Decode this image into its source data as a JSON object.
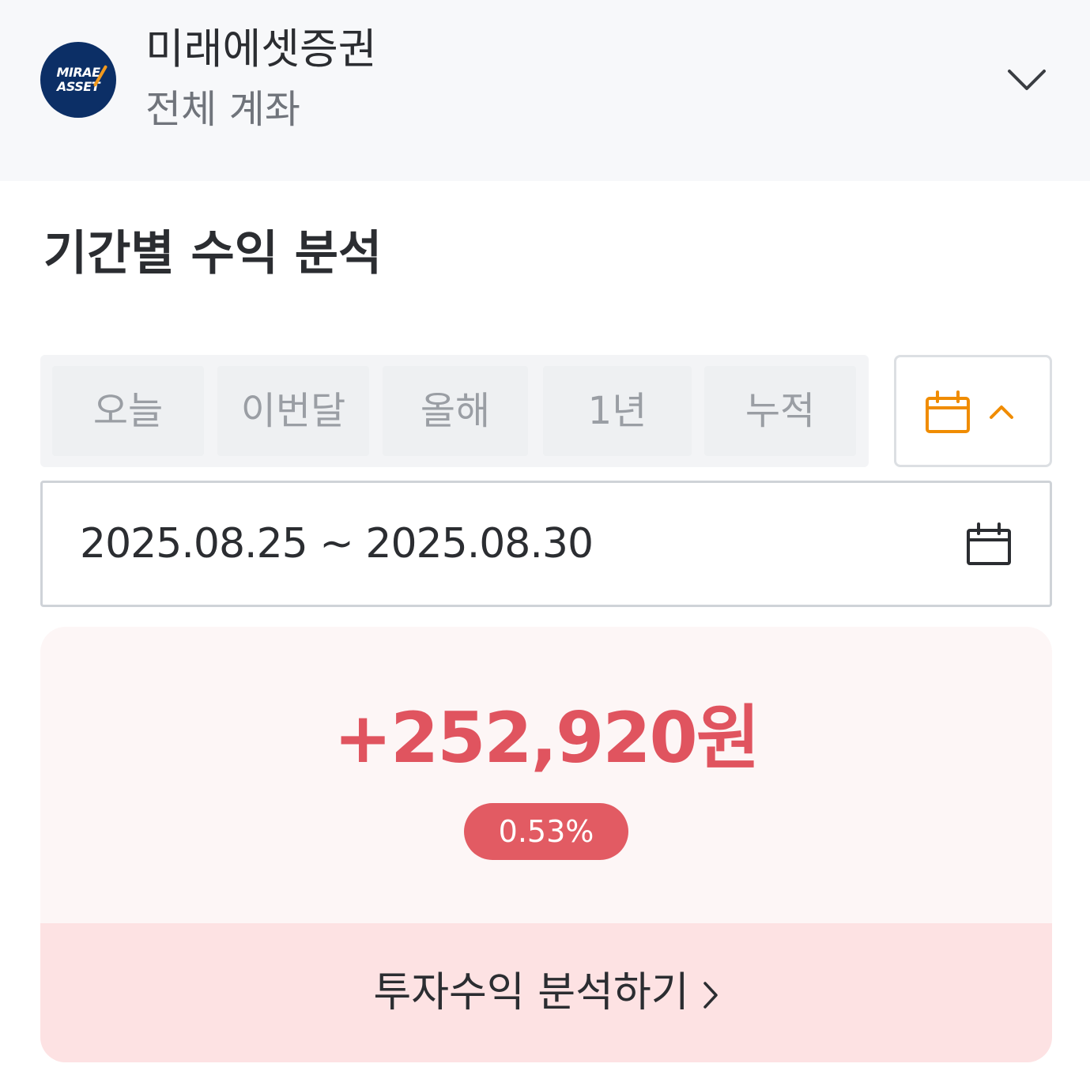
{
  "header": {
    "logo_line1": "MIRAE",
    "logo_line2": "ASSET",
    "broker_name": "미래에셋증권",
    "account_name": "전체 계좌",
    "dropdown_icon": "chevron-down-icon"
  },
  "section": {
    "title": "기간별 수익 분석"
  },
  "period_tabs": [
    {
      "label": "오늘"
    },
    {
      "label": "이번달"
    },
    {
      "label": "올해"
    },
    {
      "label": "1년"
    },
    {
      "label": "누적"
    }
  ],
  "calendar_toggle": {
    "icon": "calendar-icon",
    "chevron": "chevron-up-icon",
    "accent_color": "#f08c00"
  },
  "date_range": {
    "value": "2025.08.25 ~ 2025.08.30",
    "icon": "calendar-icon"
  },
  "summary": {
    "profit_amount": "+252,920원",
    "return_rate": "0.53%",
    "profit_color": "#e0545f",
    "analyze_button_label": "투자수익 분석하기",
    "analyze_button_icon": "chevron-right-icon"
  }
}
